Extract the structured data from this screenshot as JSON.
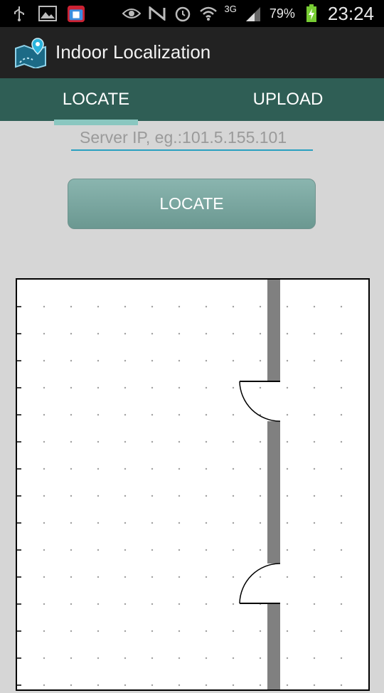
{
  "status_bar": {
    "battery": "79%",
    "network": "3G",
    "time": "23:24"
  },
  "app_bar": {
    "title": "Indoor Localization"
  },
  "tabs": [
    {
      "label": "LOCATE",
      "selected": true
    },
    {
      "label": "UPLOAD",
      "selected": false
    }
  ],
  "server_input": {
    "value": "",
    "placeholder": "Server IP, eg.:101.5.155.101"
  },
  "locate_button": {
    "label": "LOCATE"
  },
  "colors": {
    "tab_bar": "#2f5e55",
    "tab_indicator": "#8ac7c0",
    "button": "#7aa7a0",
    "input_underline": "#2aa0c0"
  }
}
